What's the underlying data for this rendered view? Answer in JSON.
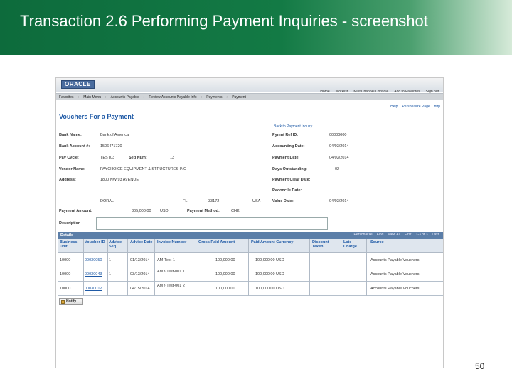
{
  "slide": {
    "title": "Transaction 2.6 Performing Payment Inquiries - screenshot",
    "page_number": "50"
  },
  "app": {
    "logo": "ORACLE",
    "top_links": [
      "Home",
      "Worklist",
      "MultiChannel Console",
      "Add to Favorites",
      "Sign out"
    ],
    "nav": [
      "Favorites",
      "Main Menu",
      "Accounts Payable",
      "Review Accounts Payable Info",
      "Payments",
      "Payment"
    ],
    "page_title": "Vouchers For a Payment",
    "help_links": [
      "Help",
      "Personalize Page",
      "http"
    ],
    "back_link": "Back to Payment Inquiry"
  },
  "left_fields": [
    {
      "label": "Bank Name:",
      "value": "Bank of America"
    },
    {
      "label": "Bank Account #:",
      "value": "1506471720"
    },
    {
      "label": "Pay Cycle:",
      "value": "TEST03",
      "label2": "Seq Num:",
      "value2": "13"
    },
    {
      "label": "Vendor Name:",
      "value": "PAYCHOICE EQUIPMENT & STRUCTURES INC"
    },
    {
      "label": "Address:",
      "value": "1800 NW 93 AVENUE"
    }
  ],
  "address_line2": {
    "city": "DORAL",
    "state": "FL",
    "zip": "33172",
    "country": "USA"
  },
  "right_fields": [
    {
      "label": "Pymnt Ref ID:",
      "value": "00000000"
    },
    {
      "label": "Accounting Date:",
      "value": "04/03/2014"
    },
    {
      "label": "Payment Date:",
      "value": "04/03/2014"
    },
    {
      "label": "Days Outstanding:",
      "value": "02"
    },
    {
      "label": "Payment Clear Date:",
      "value": ""
    },
    {
      "label": "Reconcile Date:",
      "value": ""
    },
    {
      "label": "Value Date:",
      "value": "04/03/2014"
    }
  ],
  "payment_amount": {
    "label": "Payment Amount:",
    "value": "305,000.00",
    "currency": "USD",
    "method_label": "Payment Method:",
    "method": "CHK"
  },
  "description_label": "Description",
  "details": {
    "title": "Details",
    "tools": [
      "Personalize",
      "Find",
      "View All",
      "First",
      "1-3 of 3",
      "Last"
    ],
    "headers": [
      "Business Unit",
      "Voucher ID",
      "Advice Seq",
      "Advice Date",
      "Invoice Number",
      "Gross Paid Amount",
      "Paid Amount  Currency",
      "Discount Taken",
      "Late Charge",
      "Source"
    ],
    "rows": [
      [
        "10000",
        "00030050",
        "1",
        "01/13/2014",
        "AM-Test-1",
        "100,000.00",
        "100,000.00 USD",
        "",
        "",
        "Accounts Payable Vouchers"
      ],
      [
        "10000",
        "00030043",
        "1",
        "03/13/2014",
        "AMY-Test-001 1",
        "100,000.00",
        "100,000.00 USD",
        "",
        "",
        "Accounts Payable Vouchers"
      ],
      [
        "10000",
        "00030012",
        "1",
        "04/15/2014",
        "AMY-Test-001 2",
        "100,000.00",
        "100,000.00 USD",
        "",
        "",
        "Accounts Payable Vouchers"
      ]
    ]
  },
  "notify_button": "Notify"
}
